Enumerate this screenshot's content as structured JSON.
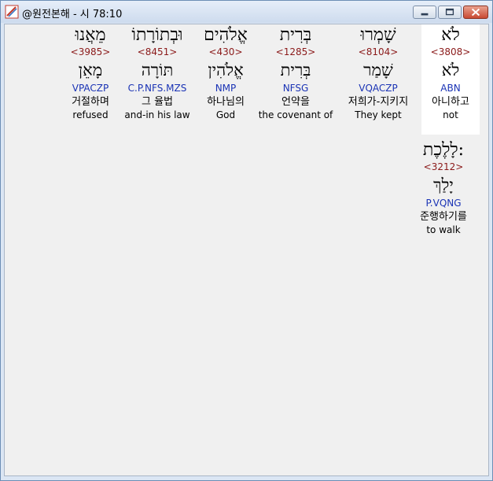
{
  "window": {
    "title": "@원전본해 - 시 78:10"
  },
  "words": [
    {
      "hebrew": "לֹא",
      "strong": "<3808>",
      "lemma": "לֹא",
      "morph": "ABN",
      "korean": "아니하고",
      "english": "not"
    },
    {
      "hebrew": "שָׁמְרוּ",
      "strong": "<8104>",
      "lemma": "שָׁמַר",
      "morph": "VQACZP",
      "korean": "저희가-지키지",
      "english": "They kept"
    },
    {
      "hebrew": "בְּרִית",
      "strong": "<1285>",
      "lemma": "בְּרִית",
      "morph": "NFSG",
      "korean": "언약을",
      "english": "the covenant of"
    },
    {
      "hebrew": "אֱלֹהִים",
      "strong": "<430>",
      "lemma": "אֱלֹהִין",
      "morph": "NMP",
      "korean": "하나님의",
      "english": "God"
    },
    {
      "hebrew": "וּבְתוֹרָתוֹ",
      "strong": "<8451>",
      "lemma": "תּוֹרָה",
      "morph": "C.P.NFS.MZS",
      "korean": "그 율법",
      "english": "and-in his law"
    },
    {
      "hebrew": "מֵאֲנוּ",
      "strong": "<3985>",
      "lemma": "מָאֵן",
      "morph": "VPACZP",
      "korean": "거절하며",
      "english": "refused"
    },
    {
      "hebrew": "לָלֶכֶת:",
      "strong": "<3212>",
      "lemma": "יָלַךְ",
      "morph": "P.VQNG",
      "korean": "준행하기를",
      "english": "to walk"
    }
  ]
}
